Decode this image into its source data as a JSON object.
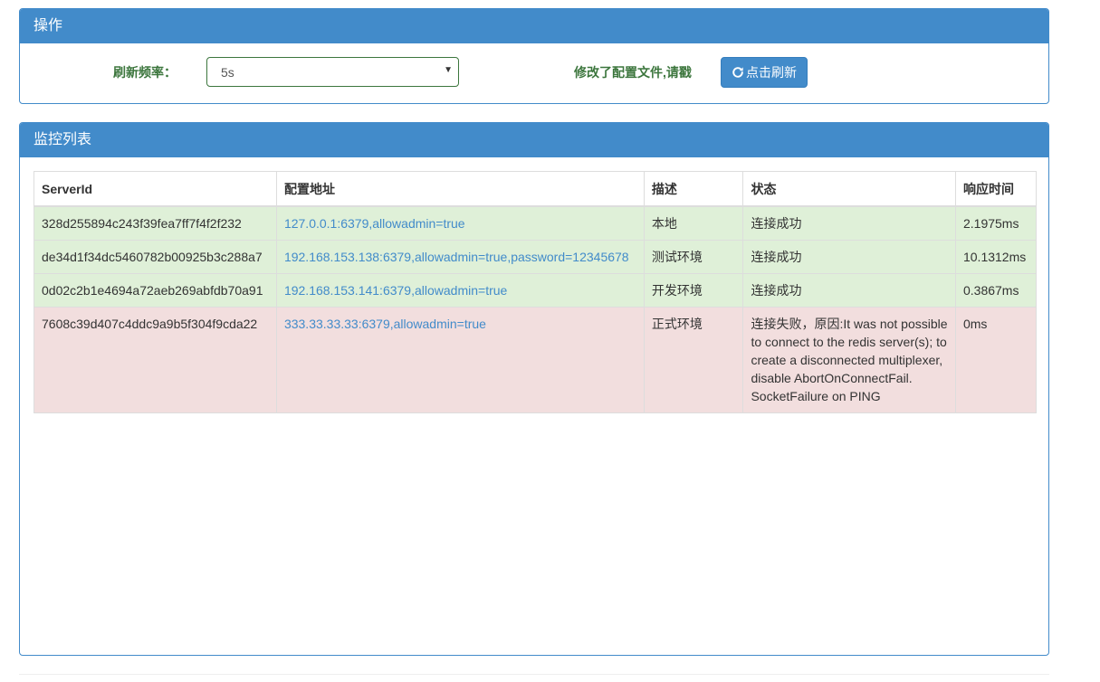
{
  "operations": {
    "title": "操作",
    "refresh_label": "刷新频率：",
    "refresh_value": "5s",
    "message": "修改了配置文件,请戳",
    "refresh_button": "点击刷新",
    "refresh_button_icon": "refresh-icon"
  },
  "monitor": {
    "title": "监控列表",
    "columns": [
      "ServerId",
      "配置地址",
      "描述",
      "状态",
      "响应时间"
    ],
    "rows": [
      {
        "status_type": "success",
        "server_id": "328d255894c243f39fea7ff7f4f2f232",
        "address": "127.0.0.1:6379,allowadmin=true",
        "description": "本地",
        "state": "连接成功",
        "response_time": "2.1975ms"
      },
      {
        "status_type": "success",
        "server_id": "de34d1f34dc5460782b00925b3c288a7",
        "address": "192.168.153.138:6379,allowadmin=true,password=12345678",
        "description": "测试环境",
        "state": "连接成功",
        "response_time": "10.1312ms"
      },
      {
        "status_type": "success",
        "server_id": "0d02c2b1e4694a72aeb269abfdb70a91",
        "address": "192.168.153.141:6379,allowadmin=true",
        "description": "开发环境",
        "state": "连接成功",
        "response_time": "0.3867ms"
      },
      {
        "status_type": "danger",
        "server_id": "7608c39d407c4ddc9a9b5f304f9cda22",
        "address": "333.33.33.33:6379,allowadmin=true",
        "description": "正式环境",
        "state": "连接失败，原因:It was not possible to connect to the redis server(s); to create a disconnected multiplexer, disable AbortOnConnectFail. SocketFailure on PING",
        "response_time": "0ms"
      }
    ]
  },
  "colors": {
    "primary": "#428bca",
    "success_text": "#3c763d",
    "success_bg": "#dff0d8",
    "danger_bg": "#f2dede"
  }
}
